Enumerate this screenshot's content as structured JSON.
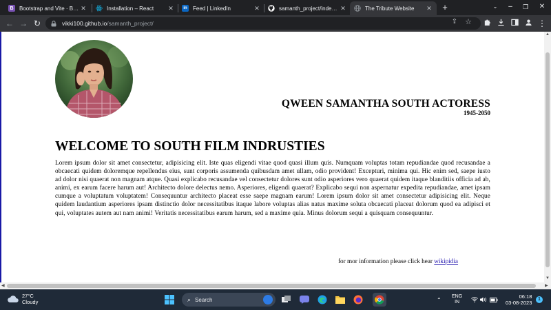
{
  "browser": {
    "tabs": [
      {
        "title": "Bootstrap and Vite · Bootstrap",
        "icon": "bootstrap-icon",
        "color": "#7952b3"
      },
      {
        "title": "Installation – React",
        "icon": "react-icon",
        "color": "#149eca"
      },
      {
        "title": "Feed | LinkedIn",
        "icon": "linkedin-icon",
        "color": "#0a66c2"
      },
      {
        "title": "samanth_project/index.html",
        "icon": "github-icon",
        "color": "#ffffff"
      },
      {
        "title": "The Tribute Website",
        "icon": "globe-icon",
        "color": "#9aa0a6"
      }
    ],
    "active_tab": 4,
    "address": {
      "host": "vikki100.github.io",
      "path": "/samanth_project/"
    }
  },
  "page": {
    "header_title": "QWEEN SAMANTHA SOUTH ACTORESS",
    "header_years": "1945-2050",
    "welcome_heading": "WELCOME TO SOUTH FILM INDRUSTIES",
    "lorem": "Lorem ipsum dolor sit amet consectetur, adipisicing elit. Iste quas eligendi vitae quod quasi illum quis. Numquam voluptas totam repudiandae quod recusandae a obcaecati quidem doloremque repellendus eius, sunt corporis assumenda quibusdam amet ullam, odio provident! Excepturi, minima qui. Hic enim sed, saepe iusto ad dolor nisi quaerat non magnam atque. Quasi explicabo recusandae vel consectetur dolores sunt odio asperiores vero quaerat quidem itaque blanditiis officia ad ab, animi, ex earum facere harum aut! Architecto dolore delectus nemo. Asperiores, eligendi quaerat? Explicabo sequi non aspernatur expedita repudiandae, amet ipsam cumque a voluptatum voluptatem! Consequuntur architecto placeat esse saepe magnam earum! Lorem ipsum dolor sit amet consectetur adipisicing elit. Neque quidem laudantium asperiores ipsam distinctio dolor necessitatibus itaque labore voluptas alias natus maxime soluta obcaecati placeat dolorum quod ea adipisci et qui, voluptates autem aut nam animi! Veritatis necessitatibus earum harum, sed a maxime quia. Minus dolorum sequi a quisquam consequuntur.",
    "footer_text": "for mor information please click hear ",
    "footer_link": "wikipidia"
  },
  "taskbar": {
    "weather_temp": "27°C",
    "weather_desc": "Cloudy",
    "search_placeholder": "Search",
    "lang_line1": "ENG",
    "lang_line2": "IN",
    "time": "06:18",
    "date": "03-08-2023",
    "notification_count": "1"
  }
}
